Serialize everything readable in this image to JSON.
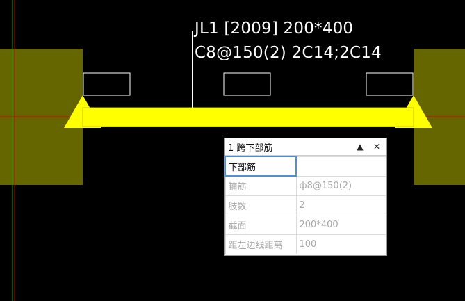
{
  "beam": {
    "label_line1": "JL1 [2009] 200*400",
    "label_line2": "C8@150(2) 2C14;2C14"
  },
  "panel": {
    "title": "1 跨下部筋",
    "pin_glyph": "▲",
    "close_glyph": "✕",
    "rows": [
      {
        "name": "下部筋",
        "value": ""
      },
      {
        "name": "箍筋",
        "value": "ф8@150(2)"
      },
      {
        "name": "肢数",
        "value": "2"
      },
      {
        "name": "截面",
        "value": "200*400"
      },
      {
        "name": "距左边线距离",
        "value": "100"
      }
    ]
  },
  "colors": {
    "background": "#000000",
    "beam": "#ffff00",
    "column": "#666600",
    "axis_red": "#cc0000",
    "axis_green": "#00aa00",
    "text": "#ffffff"
  }
}
